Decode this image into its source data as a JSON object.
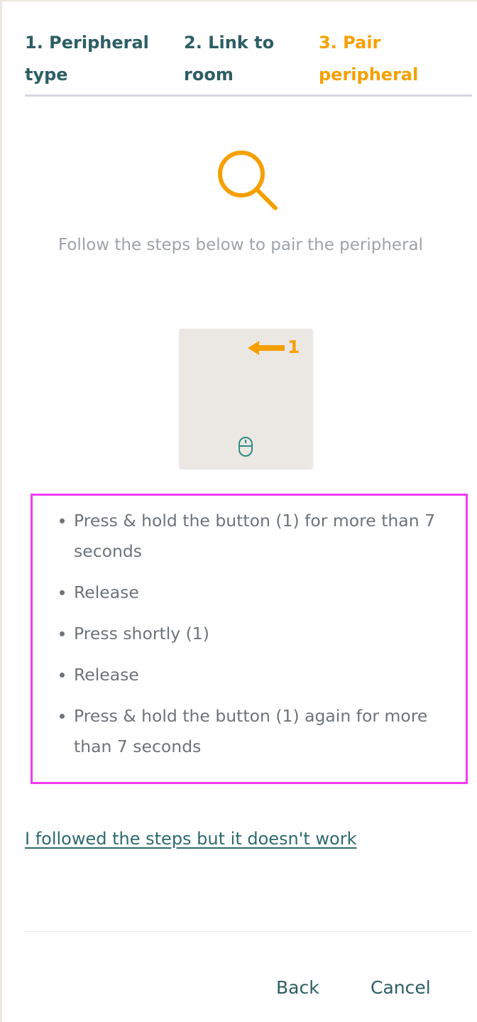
{
  "stepper": {
    "steps": [
      {
        "label": "1. Peripheral type",
        "state": "done"
      },
      {
        "label": "2. Link to room",
        "state": "done"
      },
      {
        "label": "3. Pair peripheral",
        "state": "active"
      }
    ]
  },
  "main": {
    "icon": "search-icon",
    "intro": "Follow the steps below to pair the peripheral",
    "device": {
      "button_number": "1",
      "icons": [
        "arrow-left-icon",
        "mouse-icon"
      ]
    },
    "instructions": [
      "Press & hold the button (1) for more than 7 seconds",
      "Release",
      "Press shortly (1)",
      "Release",
      "Press & hold the button (1) again for more than 7 seconds"
    ],
    "help_link": "I followed the steps but it doesn't work"
  },
  "footer": {
    "back_label": "Back",
    "cancel_label": "Cancel"
  },
  "colors": {
    "primary": "#2c5e64",
    "accent": "#f5a000",
    "highlight": "#f23bf0",
    "muted": "#9ea3a7"
  }
}
